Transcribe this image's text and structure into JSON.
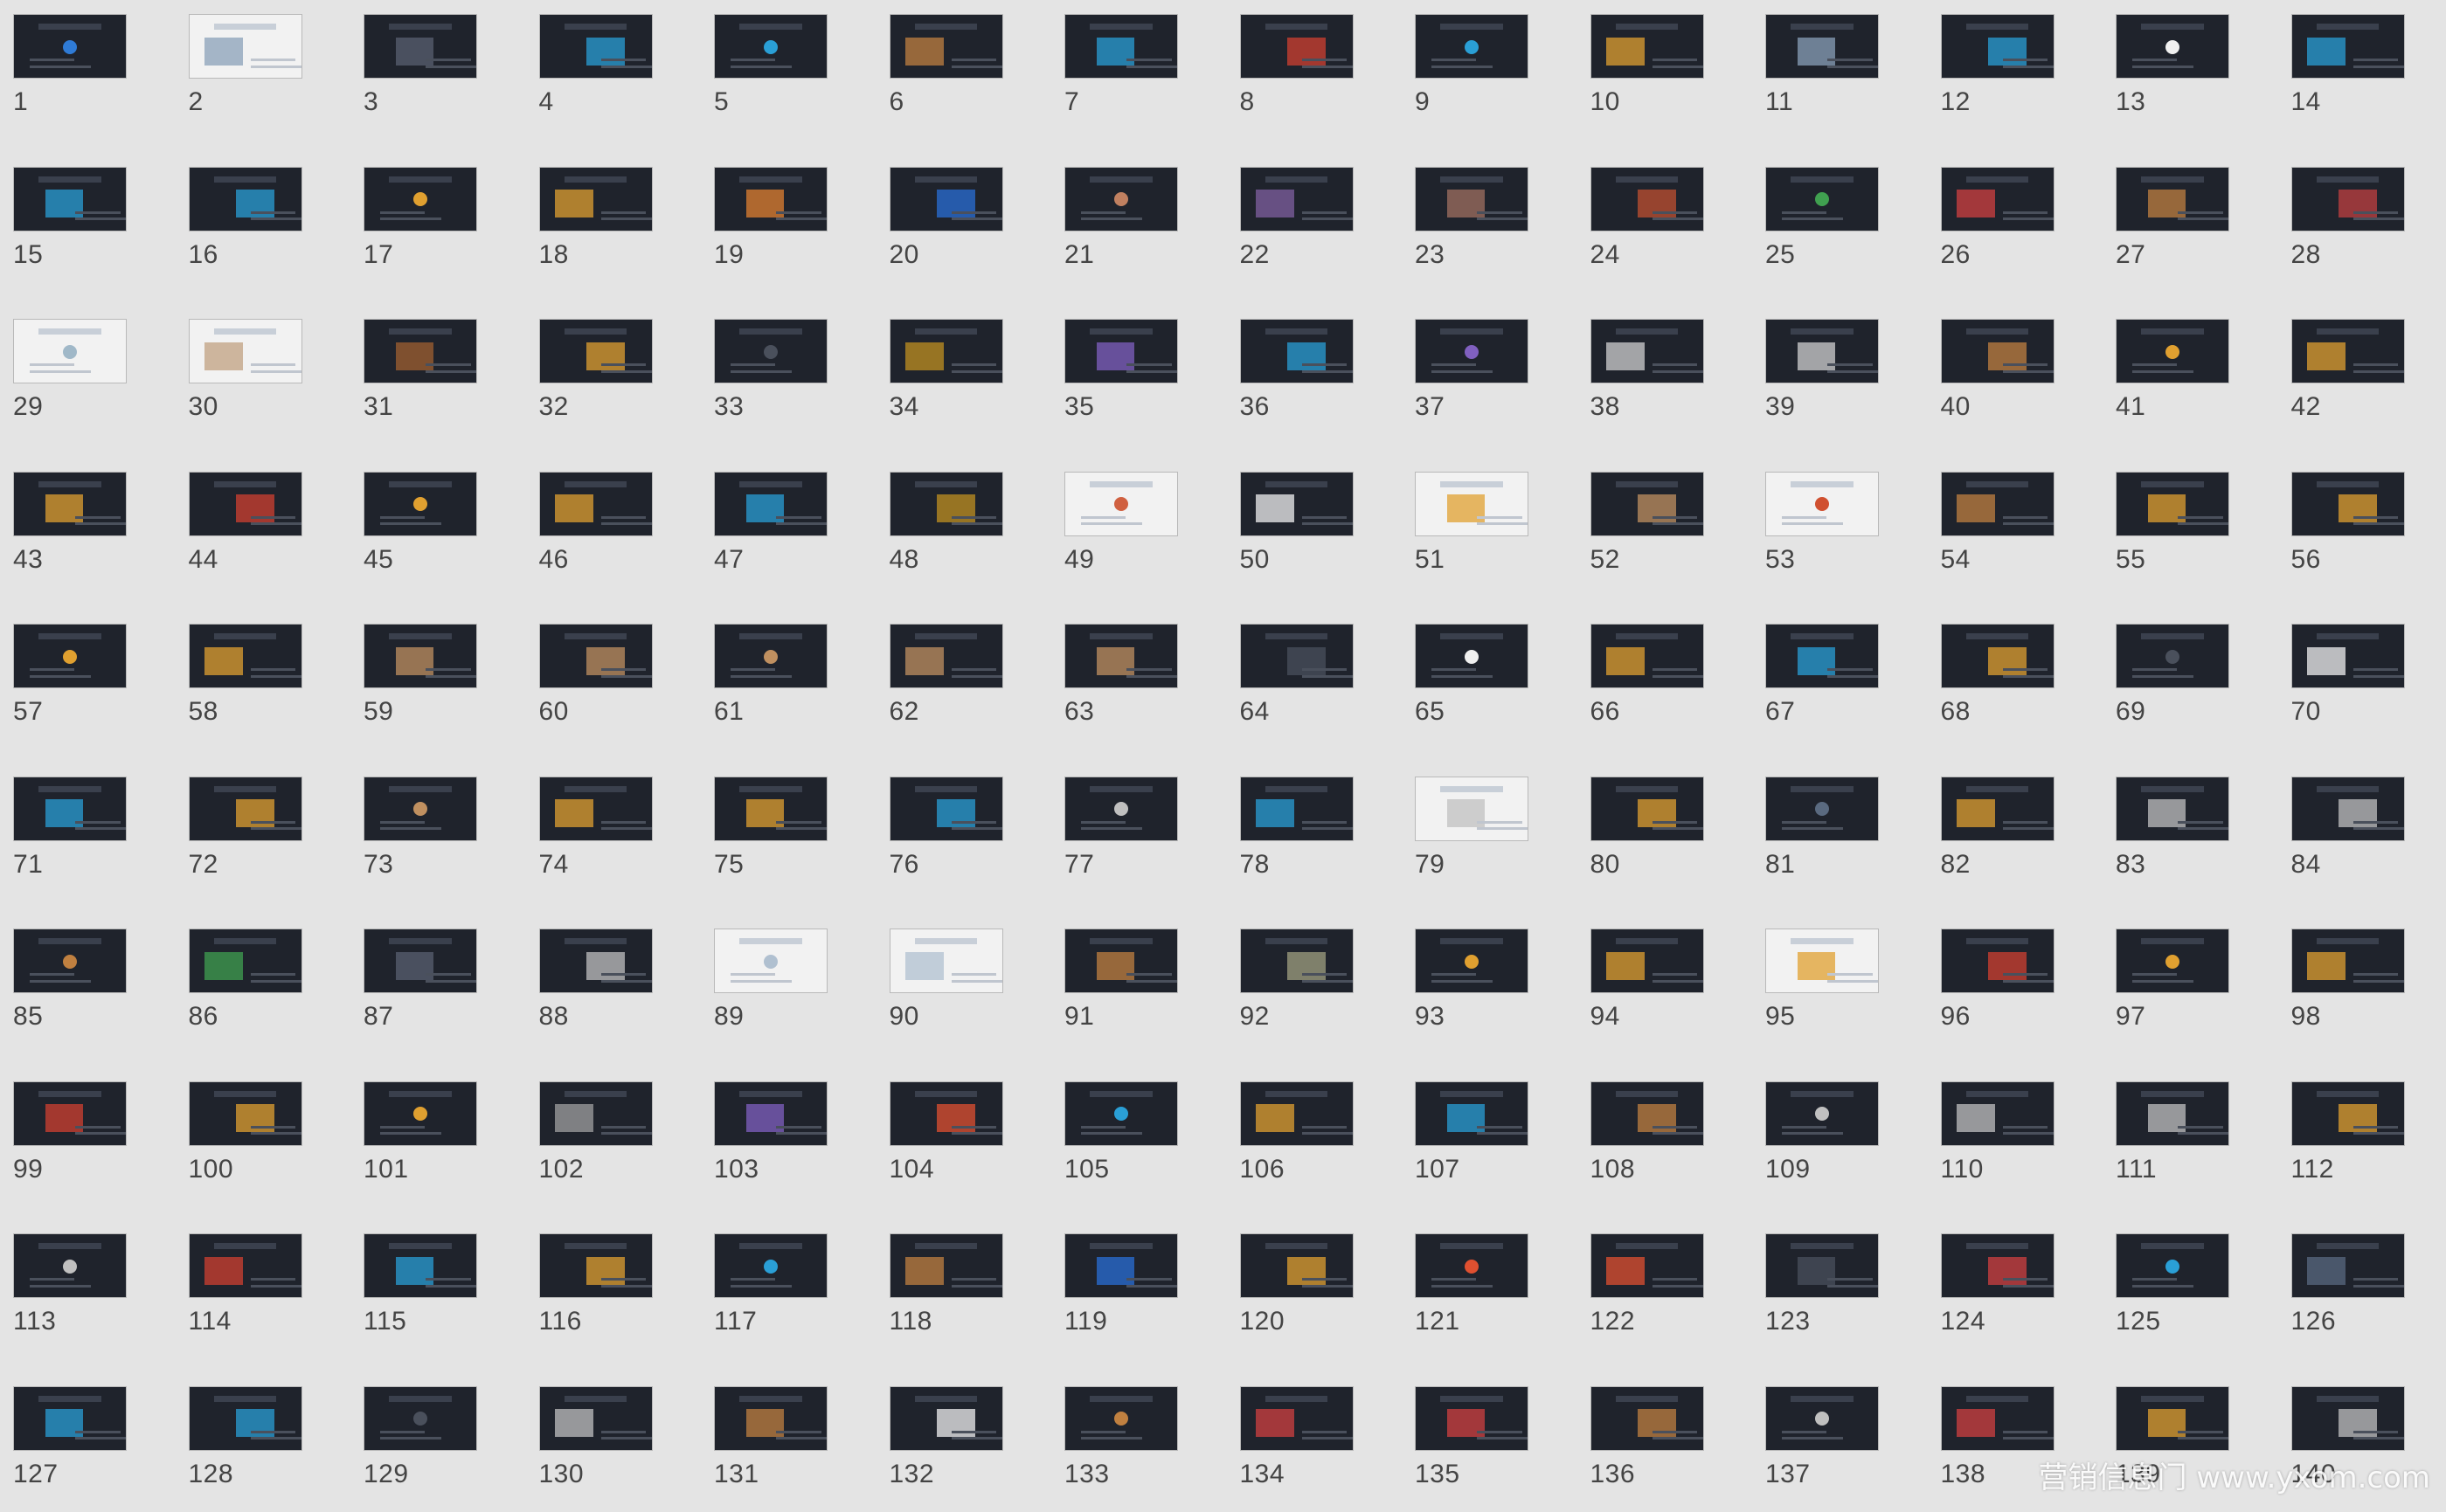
{
  "slides": [
    {
      "n": "1",
      "s": "dark",
      "accent": "#2f7bd6"
    },
    {
      "n": "2",
      "s": "light",
      "accent": "#8aa0b8"
    },
    {
      "n": "3",
      "s": "dark",
      "accent": "#5a6070"
    },
    {
      "n": "4",
      "s": "dark",
      "accent": "#2a9fd6"
    },
    {
      "n": "5",
      "s": "dark",
      "accent": "#2a9fd6"
    },
    {
      "n": "6",
      "s": "dark",
      "accent": "#c08040"
    },
    {
      "n": "7",
      "s": "dark",
      "accent": "#2a9fd6"
    },
    {
      "n": "8",
      "s": "dark",
      "accent": "#d04030"
    },
    {
      "n": "9",
      "s": "dark",
      "accent": "#2a9fd6"
    },
    {
      "n": "10",
      "s": "dark",
      "accent": "#e0a030"
    },
    {
      "n": "11",
      "s": "dark",
      "accent": "#8aa0b8"
    },
    {
      "n": "12",
      "s": "dark",
      "accent": "#2a9fd6"
    },
    {
      "n": "13",
      "s": "dark",
      "accent": "#f0f0f0"
    },
    {
      "n": "14",
      "s": "dark",
      "accent": "#2a9fd6"
    },
    {
      "n": "15",
      "s": "dark",
      "accent": "#2a9fd6"
    },
    {
      "n": "16",
      "s": "dark",
      "accent": "#2a9fd6"
    },
    {
      "n": "17",
      "s": "dark",
      "accent": "#e0a030"
    },
    {
      "n": "18",
      "s": "dark",
      "accent": "#e0a030"
    },
    {
      "n": "19",
      "s": "dark",
      "accent": "#e08030"
    },
    {
      "n": "20",
      "s": "dark",
      "accent": "#2a6fd6"
    },
    {
      "n": "21",
      "s": "dark",
      "accent": "#c08060"
    },
    {
      "n": "22",
      "s": "dark",
      "accent": "#8060a0"
    },
    {
      "n": "23",
      "s": "dark",
      "accent": "#a07060"
    },
    {
      "n": "24",
      "s": "dark",
      "accent": "#c05030"
    },
    {
      "n": "25",
      "s": "dark",
      "accent": "#40a050"
    },
    {
      "n": "26",
      "s": "dark",
      "accent": "#d04040"
    },
    {
      "n": "27",
      "s": "dark",
      "accent": "#c08040"
    },
    {
      "n": "28",
      "s": "dark",
      "accent": "#c04040"
    },
    {
      "n": "29",
      "s": "light",
      "accent": "#a0b8c8"
    },
    {
      "n": "30",
      "s": "light",
      "accent": "#c0a080"
    },
    {
      "n": "31",
      "s": "dark",
      "accent": "#a06030"
    },
    {
      "n": "32",
      "s": "dark",
      "accent": "#e0a030"
    },
    {
      "n": "33",
      "s": "dark",
      "accent": "#4a505c"
    },
    {
      "n": "34",
      "s": "dark",
      "accent": "#c09020"
    },
    {
      "n": "35",
      "s": "dark",
      "accent": "#8060c0"
    },
    {
      "n": "36",
      "s": "dark",
      "accent": "#2a9fd6"
    },
    {
      "n": "37",
      "s": "dark",
      "accent": "#8060c0"
    },
    {
      "n": "38",
      "s": "dark",
      "accent": "#d0d0d0"
    },
    {
      "n": "39",
      "s": "dark",
      "accent": "#d0d0d0"
    },
    {
      "n": "40",
      "s": "dark",
      "accent": "#c08040"
    },
    {
      "n": "41",
      "s": "dark",
      "accent": "#e0a030"
    },
    {
      "n": "42",
      "s": "dark",
      "accent": "#e0a030"
    },
    {
      "n": "43",
      "s": "dark",
      "accent": "#e0a030"
    },
    {
      "n": "44",
      "s": "dark",
      "accent": "#d04030"
    },
    {
      "n": "45",
      "s": "dark",
      "accent": "#e0a030"
    },
    {
      "n": "46",
      "s": "dark",
      "accent": "#e0a030"
    },
    {
      "n": "47",
      "s": "dark",
      "accent": "#2a9fd6"
    },
    {
      "n": "48",
      "s": "dark",
      "accent": "#c09020"
    },
    {
      "n": "49",
      "s": "light",
      "accent": "#d06040"
    },
    {
      "n": "50",
      "s": "dark",
      "accent": "#f0f0f0"
    },
    {
      "n": "51",
      "s": "light",
      "accent": "#e0a030"
    },
    {
      "n": "52",
      "s": "dark",
      "accent": "#c09060"
    },
    {
      "n": "53",
      "s": "light",
      "accent": "#d05030"
    },
    {
      "n": "54",
      "s": "dark",
      "accent": "#c08040"
    },
    {
      "n": "55",
      "s": "dark",
      "accent": "#e0a030"
    },
    {
      "n": "56",
      "s": "dark",
      "accent": "#e0a030"
    },
    {
      "n": "57",
      "s": "dark",
      "accent": "#e0a030"
    },
    {
      "n": "58",
      "s": "dark",
      "accent": "#e0a030"
    },
    {
      "n": "59",
      "s": "dark",
      "accent": "#c09060"
    },
    {
      "n": "60",
      "s": "dark",
      "accent": "#c09060"
    },
    {
      "n": "61",
      "s": "dark",
      "accent": "#c09060"
    },
    {
      "n": "62",
      "s": "dark",
      "accent": "#c09060"
    },
    {
      "n": "63",
      "s": "dark",
      "accent": "#c09060"
    },
    {
      "n": "64",
      "s": "dark",
      "accent": "#4a505c"
    },
    {
      "n": "65",
      "s": "dark",
      "accent": "#f0f0f0"
    },
    {
      "n": "66",
      "s": "dark",
      "accent": "#e0a030"
    },
    {
      "n": "67",
      "s": "dark",
      "accent": "#2a9fd6"
    },
    {
      "n": "68",
      "s": "dark",
      "accent": "#e0a030"
    },
    {
      "n": "69",
      "s": "dark",
      "accent": "#4a505c"
    },
    {
      "n": "70",
      "s": "dark",
      "accent": "#f0f0f0"
    },
    {
      "n": "71",
      "s": "dark",
      "accent": "#2a9fd6"
    },
    {
      "n": "72",
      "s": "dark",
      "accent": "#e0a030"
    },
    {
      "n": "73",
      "s": "dark",
      "accent": "#c09060"
    },
    {
      "n": "74",
      "s": "dark",
      "accent": "#e0a030"
    },
    {
      "n": "75",
      "s": "dark",
      "accent": "#e0a030"
    },
    {
      "n": "76",
      "s": "dark",
      "accent": "#2a9fd6"
    },
    {
      "n": "77",
      "s": "dark",
      "accent": "#c0c0c0"
    },
    {
      "n": "78",
      "s": "dark",
      "accent": "#2a9fd6"
    },
    {
      "n": "79",
      "s": "light",
      "accent": "#c0c0c0"
    },
    {
      "n": "80",
      "s": "dark",
      "accent": "#e0a030"
    },
    {
      "n": "81",
      "s": "dark",
      "accent": "#5a6a80"
    },
    {
      "n": "82",
      "s": "dark",
      "accent": "#e0a030"
    },
    {
      "n": "83",
      "s": "dark",
      "accent": "#c0c0c0"
    },
    {
      "n": "84",
      "s": "dark",
      "accent": "#c0c0c0"
    },
    {
      "n": "85",
      "s": "dark",
      "accent": "#c08040"
    },
    {
      "n": "86",
      "s": "dark",
      "accent": "#40a050"
    },
    {
      "n": "87",
      "s": "dark",
      "accent": "#5a6070"
    },
    {
      "n": "88",
      "s": "dark",
      "accent": "#c0c0c0"
    },
    {
      "n": "89",
      "s": "light",
      "accent": "#b0c0d0"
    },
    {
      "n": "90",
      "s": "light",
      "accent": "#b0c0d0"
    },
    {
      "n": "91",
      "s": "dark",
      "accent": "#c08040"
    },
    {
      "n": "92",
      "s": "dark",
      "accent": "#a0a080"
    },
    {
      "n": "93",
      "s": "dark",
      "accent": "#e0a030"
    },
    {
      "n": "94",
      "s": "dark",
      "accent": "#e0a030"
    },
    {
      "n": "95",
      "s": "light",
      "accent": "#e0a030"
    },
    {
      "n": "96",
      "s": "dark",
      "accent": "#d04030"
    },
    {
      "n": "97",
      "s": "dark",
      "accent": "#e0a030"
    },
    {
      "n": "98",
      "s": "dark",
      "accent": "#e0a030"
    },
    {
      "n": "99",
      "s": "dark",
      "accent": "#d04030"
    },
    {
      "n": "100",
      "s": "dark",
      "accent": "#e0a030"
    },
    {
      "n": "101",
      "s": "dark",
      "accent": "#e0a030"
    },
    {
      "n": "102",
      "s": "dark",
      "accent": "#a0a0a0"
    },
    {
      "n": "103",
      "s": "dark",
      "accent": "#8060c0"
    },
    {
      "n": "104",
      "s": "dark",
      "accent": "#e05030"
    },
    {
      "n": "105",
      "s": "dark",
      "accent": "#2a9fd6"
    },
    {
      "n": "106",
      "s": "dark",
      "accent": "#e0a030"
    },
    {
      "n": "107",
      "s": "dark",
      "accent": "#2a9fd6"
    },
    {
      "n": "108",
      "s": "dark",
      "accent": "#c08040"
    },
    {
      "n": "109",
      "s": "dark",
      "accent": "#c0c0c0"
    },
    {
      "n": "110",
      "s": "dark",
      "accent": "#c0c0c0"
    },
    {
      "n": "111",
      "s": "dark",
      "accent": "#c0c0c0"
    },
    {
      "n": "112",
      "s": "dark",
      "accent": "#e0a030"
    },
    {
      "n": "113",
      "s": "dark",
      "accent": "#c0c0c0"
    },
    {
      "n": "114",
      "s": "dark",
      "accent": "#d04030"
    },
    {
      "n": "115",
      "s": "dark",
      "accent": "#2a9fd6"
    },
    {
      "n": "116",
      "s": "dark",
      "accent": "#e0a030"
    },
    {
      "n": "117",
      "s": "dark",
      "accent": "#2a9fd6"
    },
    {
      "n": "118",
      "s": "dark",
      "accent": "#c08040"
    },
    {
      "n": "119",
      "s": "dark",
      "accent": "#2a6fd6"
    },
    {
      "n": "120",
      "s": "dark",
      "accent": "#e0a030"
    },
    {
      "n": "121",
      "s": "dark",
      "accent": "#e05030"
    },
    {
      "n": "122",
      "s": "dark",
      "accent": "#e05030"
    },
    {
      "n": "123",
      "s": "dark",
      "accent": "#4a505c"
    },
    {
      "n": "124",
      "s": "dark",
      "accent": "#d04040"
    },
    {
      "n": "125",
      "s": "dark",
      "accent": "#2a9fd6"
    },
    {
      "n": "126",
      "s": "dark",
      "accent": "#5a6a80"
    },
    {
      "n": "127",
      "s": "dark",
      "accent": "#2a9fd6"
    },
    {
      "n": "128",
      "s": "dark",
      "accent": "#2a9fd6"
    },
    {
      "n": "129",
      "s": "dark",
      "accent": "#4a505c"
    },
    {
      "n": "130",
      "s": "dark",
      "accent": "#c0c0c0"
    },
    {
      "n": "131",
      "s": "dark",
      "accent": "#c08040"
    },
    {
      "n": "132",
      "s": "dark",
      "accent": "#f0f0f0"
    },
    {
      "n": "133",
      "s": "dark",
      "accent": "#c08040"
    },
    {
      "n": "134",
      "s": "dark",
      "accent": "#d04040"
    },
    {
      "n": "135",
      "s": "dark",
      "accent": "#d04040"
    },
    {
      "n": "136",
      "s": "dark",
      "accent": "#c08040"
    },
    {
      "n": "137",
      "s": "dark",
      "accent": "#c0c0c0"
    },
    {
      "n": "138",
      "s": "dark",
      "accent": "#d04040"
    },
    {
      "n": "139",
      "s": "dark",
      "accent": "#e0a030"
    },
    {
      "n": "140",
      "s": "dark",
      "accent": "#c0c0c0"
    }
  ],
  "watermark": "营销信息门 www.yxom.com"
}
